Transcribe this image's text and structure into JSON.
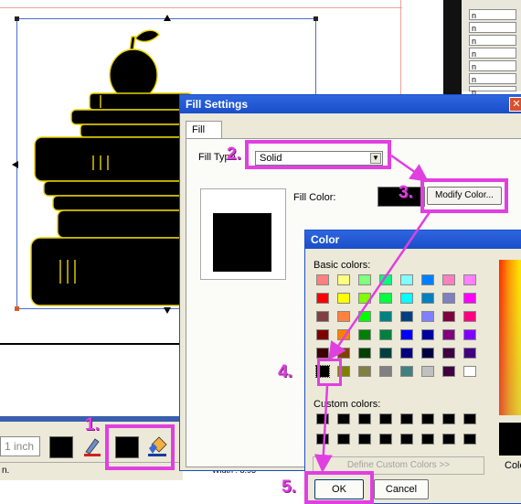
{
  "right_panel": {
    "rows": [
      "n",
      "n",
      "n",
      "n",
      "n",
      "n",
      "n"
    ]
  },
  "toolbar": {
    "unit": "1 inch",
    "status_text": "n.",
    "width_text": "Width : 8.93"
  },
  "fill_dialog": {
    "title": "Fill Settings",
    "close_glyph": "✕",
    "tab": "Fill",
    "fill_type_label": "Fill Type",
    "fill_type_value": "Solid",
    "fill_color_label": "Fill Color:",
    "modify_button": "Modify Color..."
  },
  "color_dialog": {
    "title": "Color",
    "basic_label": "Basic colors:",
    "custom_label": "Custom colors:",
    "define_button": "Define Custom Colors >>",
    "ok_button": "OK",
    "cancel_button": "Cancel",
    "side_label": "Colo",
    "basic_colors": [
      [
        "#ff8080",
        "#ffff80",
        "#80ff80",
        "#00ff80",
        "#80ffff",
        "#0080ff",
        "#ff80c0",
        "#ff80ff"
      ],
      [
        "#ff0000",
        "#ffff00",
        "#80ff00",
        "#00ff40",
        "#00ffff",
        "#0080c0",
        "#8080c0",
        "#ff00ff"
      ],
      [
        "#804040",
        "#ff8040",
        "#00ff00",
        "#008080",
        "#004080",
        "#8080ff",
        "#800040",
        "#ff0080"
      ],
      [
        "#800000",
        "#ff8000",
        "#008000",
        "#008040",
        "#0000ff",
        "#0000a0",
        "#800080",
        "#8000ff"
      ],
      [
        "#400000",
        "#804000",
        "#004000",
        "#004040",
        "#000080",
        "#000040",
        "#400040",
        "#400080"
      ],
      [
        "#000000",
        "#808000",
        "#808040",
        "#808080",
        "#408080",
        "#c0c0c0",
        "#400040",
        "#ffffff"
      ]
    ]
  },
  "steps": [
    "1.",
    "2.",
    "3.",
    "4.",
    "5."
  ]
}
